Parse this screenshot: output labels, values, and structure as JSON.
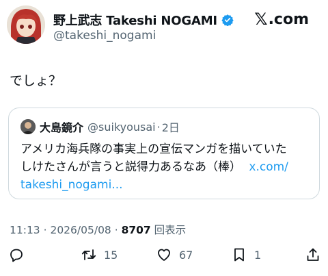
{
  "author": {
    "display_name": "野上武志 Takeshi NOGAMI",
    "handle": "@takeshi_nogami"
  },
  "brand": {
    "logo_x": "𝕏",
    "logo_rest": ".com"
  },
  "tweet": {
    "text": "でしょ？"
  },
  "quote": {
    "display_name": "大島鏡介",
    "handle": "@suikyousai",
    "separator": "·",
    "age": "2日",
    "line1": "アメリカ海兵隊の事実上の宣伝マンガを描いていた",
    "line2_text": "しけたさんが言うと説得力あるなあ（棒）",
    "link_part1": "x.com/",
    "link_part2": "takeshi_nogami..."
  },
  "meta": {
    "time": "11:13",
    "dot1": " · ",
    "date": "2026/05/08",
    "dot2": " · ",
    "views": "8707",
    "views_label": " 回表示"
  },
  "actions": {
    "reply_icon": "reply-icon",
    "retweet_count": "15",
    "like_count": "67",
    "bookmark_count": "1"
  },
  "colors": {
    "accent": "#1d9bf0",
    "secondary_text": "#536471",
    "border": "#cfd9de"
  }
}
